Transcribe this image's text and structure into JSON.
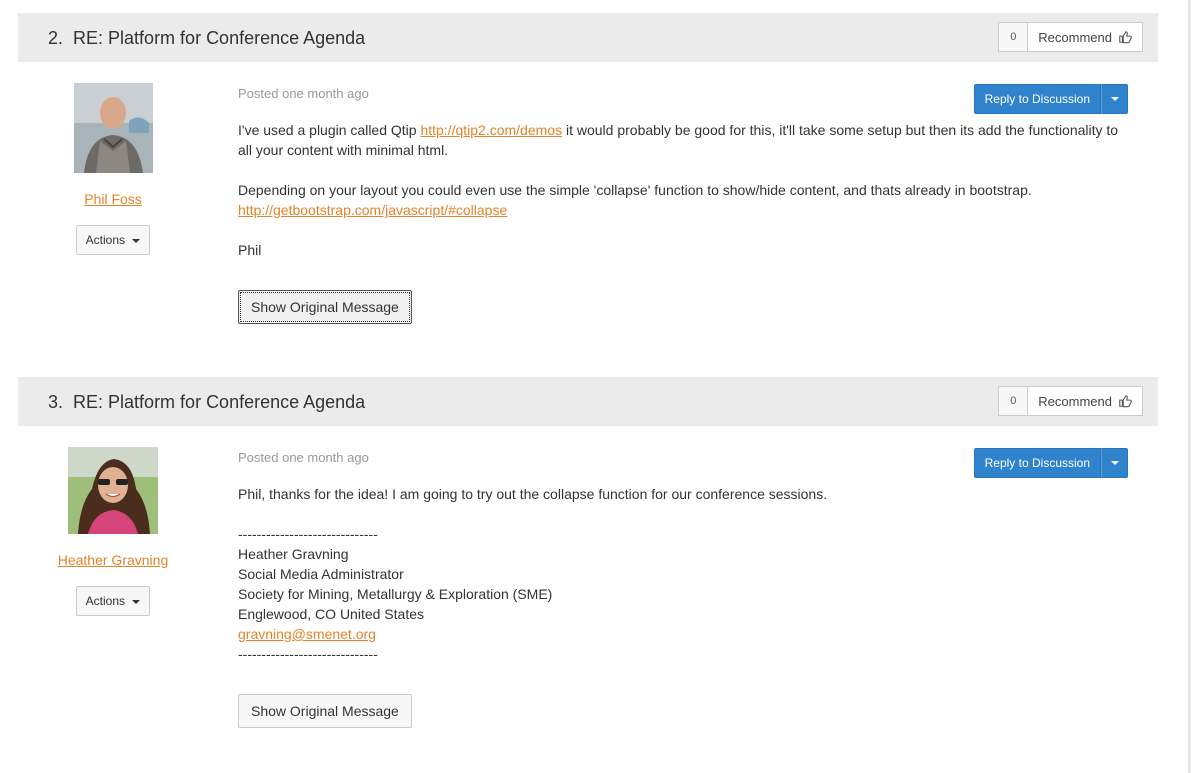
{
  "posts": [
    {
      "number": "2.",
      "title": "RE: Platform for Conference Agenda",
      "recommend_count": "0",
      "recommend_label": "Recommend",
      "author": "Phil Foss",
      "actions_label": "Actions",
      "posted": "Posted one month ago",
      "reply_label": "Reply to Discussion",
      "body": {
        "p1_pre": "I've used a plugin called Qtip ",
        "p1_link": "http://qtip2.com/demos",
        "p1_post": " it would probably be good for this, it'll take some setup but then its add the functionality to all your content with minimal html.",
        "p2_text": "Depending on your layout you could even use the simple 'collapse' function to show/hide content, and thats already in bootstrap.",
        "p2_link": "http://getbootstrap.com/javascript/#collapse",
        "sign": "Phil"
      },
      "show_original_label": "Show Original Message"
    },
    {
      "number": "3.",
      "title": "RE: Platform for Conference Agenda",
      "recommend_count": "0",
      "recommend_label": "Recommend",
      "author": "Heather Gravning",
      "actions_label": "Actions",
      "posted": "Posted one month ago",
      "reply_label": "Reply to Discussion",
      "body": {
        "p1": "Phil, thanks for the idea! I am going to try out the collapse function for our conference sessions.",
        "separator": "------------------------------",
        "sig_name": "Heather Gravning",
        "sig_title": "Social Media Administrator",
        "sig_org": "Society for Mining, Metallurgy & Exploration (SME)",
        "sig_location": "Englewood, CO United States",
        "sig_email": "gravning@smenet.org"
      },
      "show_original_label": "Show Original Message"
    }
  ],
  "icons": {
    "thumb": "thumbs-up-icon",
    "caret": "caret-down-icon"
  }
}
